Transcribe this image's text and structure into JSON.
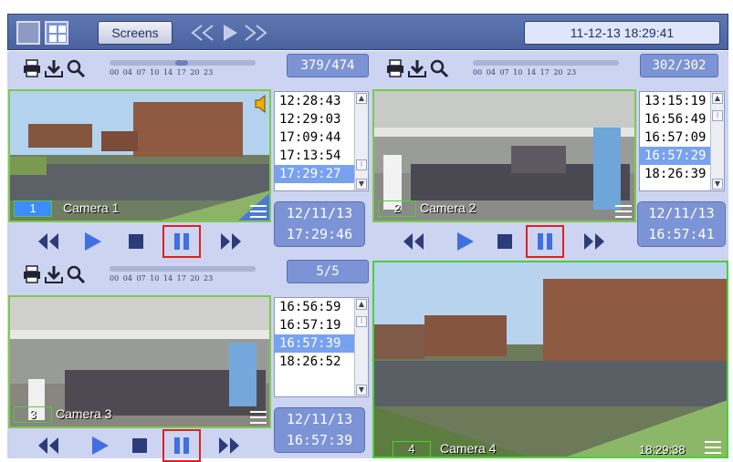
{
  "topbar": {
    "screens_label": "Screens",
    "datetime": "11-12-13  18:29:41"
  },
  "cameras": [
    {
      "number": "1",
      "name": "Camera 1",
      "counter": "379/474",
      "times": [
        "12:28:43",
        "12:29:03",
        "17:09:44",
        "17:13:54",
        "17:29:27"
      ],
      "selected_index": 4,
      "date": "12/11/13",
      "time": "17:29:46"
    },
    {
      "number": "2",
      "name": "Camera 2",
      "counter": "302/302",
      "times": [
        "13:15:19",
        "16:56:49",
        "16:57:09",
        "16:57:29",
        "18:26:39"
      ],
      "selected_index": 3,
      "date": "12/11/13",
      "time": "16:57:41"
    },
    {
      "number": "3",
      "name": "Camera 3",
      "counter": "5/5",
      "times": [
        "16:56:59",
        "16:57:19",
        "16:57:39",
        "18:26:52"
      ],
      "selected_index": 2,
      "date": "12/11/13",
      "time": "16:57:39"
    },
    {
      "number": "4",
      "name": "Camera 4",
      "live_time": "18:29:38"
    }
  ],
  "timeline_ticks": "00 04 07 10  14  17  20 23",
  "colors": {
    "accent": "#7c93d6",
    "panel_bg": "#ccd4f1",
    "selection": "#78a2f0",
    "frame_green": "#7ec84e",
    "pause_highlight": "#e02020"
  }
}
